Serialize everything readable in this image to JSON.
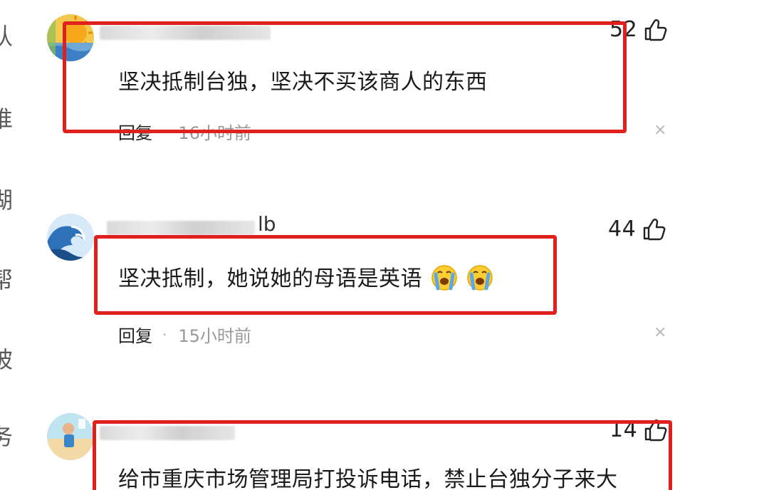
{
  "left_edge": {
    "glyphs": [
      "认",
      "谁",
      "湖",
      "帮",
      "被",
      "务"
    ]
  },
  "comments": [
    {
      "username_suffix": "",
      "like_count": "52",
      "text": "坚决抵制台独，坚决不买该商人的东西",
      "reply_label": "回复",
      "separator": "·",
      "time": "16小时前",
      "close_glyph": "×"
    },
    {
      "username_suffix": "lb",
      "like_count": "44",
      "text": "坚决抵制，她说她的母语是英语",
      "reply_label": "回复",
      "separator": "·",
      "time": "15小时前",
      "close_glyph": "×",
      "emoji": [
        "crying-face-icon",
        "crying-face-icon"
      ]
    },
    {
      "username_suffix": "",
      "like_count": "14",
      "text": "给市重庆市场管理局打投诉电话，禁止台独分子来大",
      "reply_label": "",
      "time": "",
      "close_glyph": ""
    }
  ],
  "colors": {
    "highlight": "#e0201c",
    "time_text": "#999999",
    "close_icon": "#b5b5b5"
  }
}
